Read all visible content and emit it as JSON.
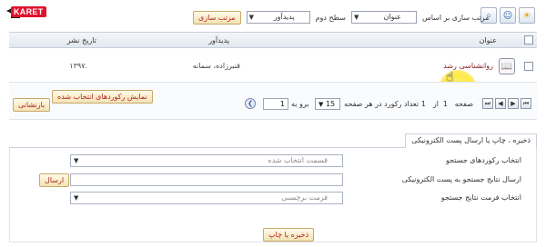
{
  "brand": {
    "logo_text": "KARET",
    "accent": "#e0112d"
  },
  "sort": {
    "label": "مرتب سازی بر اساس",
    "first_value": "عنوان",
    "level2_label": "سطح دوم",
    "second_value": "پدیدآور",
    "button": "مرتب سازی"
  },
  "toolbar": {
    "icons": [
      "search-icon",
      "user-search-icon",
      "sun-icon"
    ]
  },
  "grid": {
    "columns": [
      "عنوان",
      "پدیدآور",
      "تاریخ نشر"
    ],
    "rows": [
      {
        "title": "روانشناسی رشد",
        "author": "قنبرزاده، سمانه",
        "date": "۱۳۹۷."
      }
    ]
  },
  "pager": {
    "page_label": "صفحه",
    "page_current": "1",
    "of_label": "از",
    "page_total": "1",
    "records_label": "تعداد رکورد در هر صفحه",
    "records_value": "15",
    "goto_label": "برو به",
    "goto_value": "1",
    "show_selected": "نمایش رکوردهای انتخاب شده",
    "reset": "بازنشانی"
  },
  "panel": {
    "tab": "ذخیره ، چاپ یا ارسال پست الکترونیکی",
    "records_label": "انتخاب رکوردهای جستجو",
    "records_value": "قسمت انتخاب شده",
    "email_label": "ارسال نتایج جستجو به پست الکترونیکی",
    "email_value": "",
    "send_button": "ارسال",
    "format_label": "انتخاب فرمت نتایج جستجو",
    "format_value": "فرمت برچسبی",
    "save_button": "ذخیره یا چاپ"
  }
}
